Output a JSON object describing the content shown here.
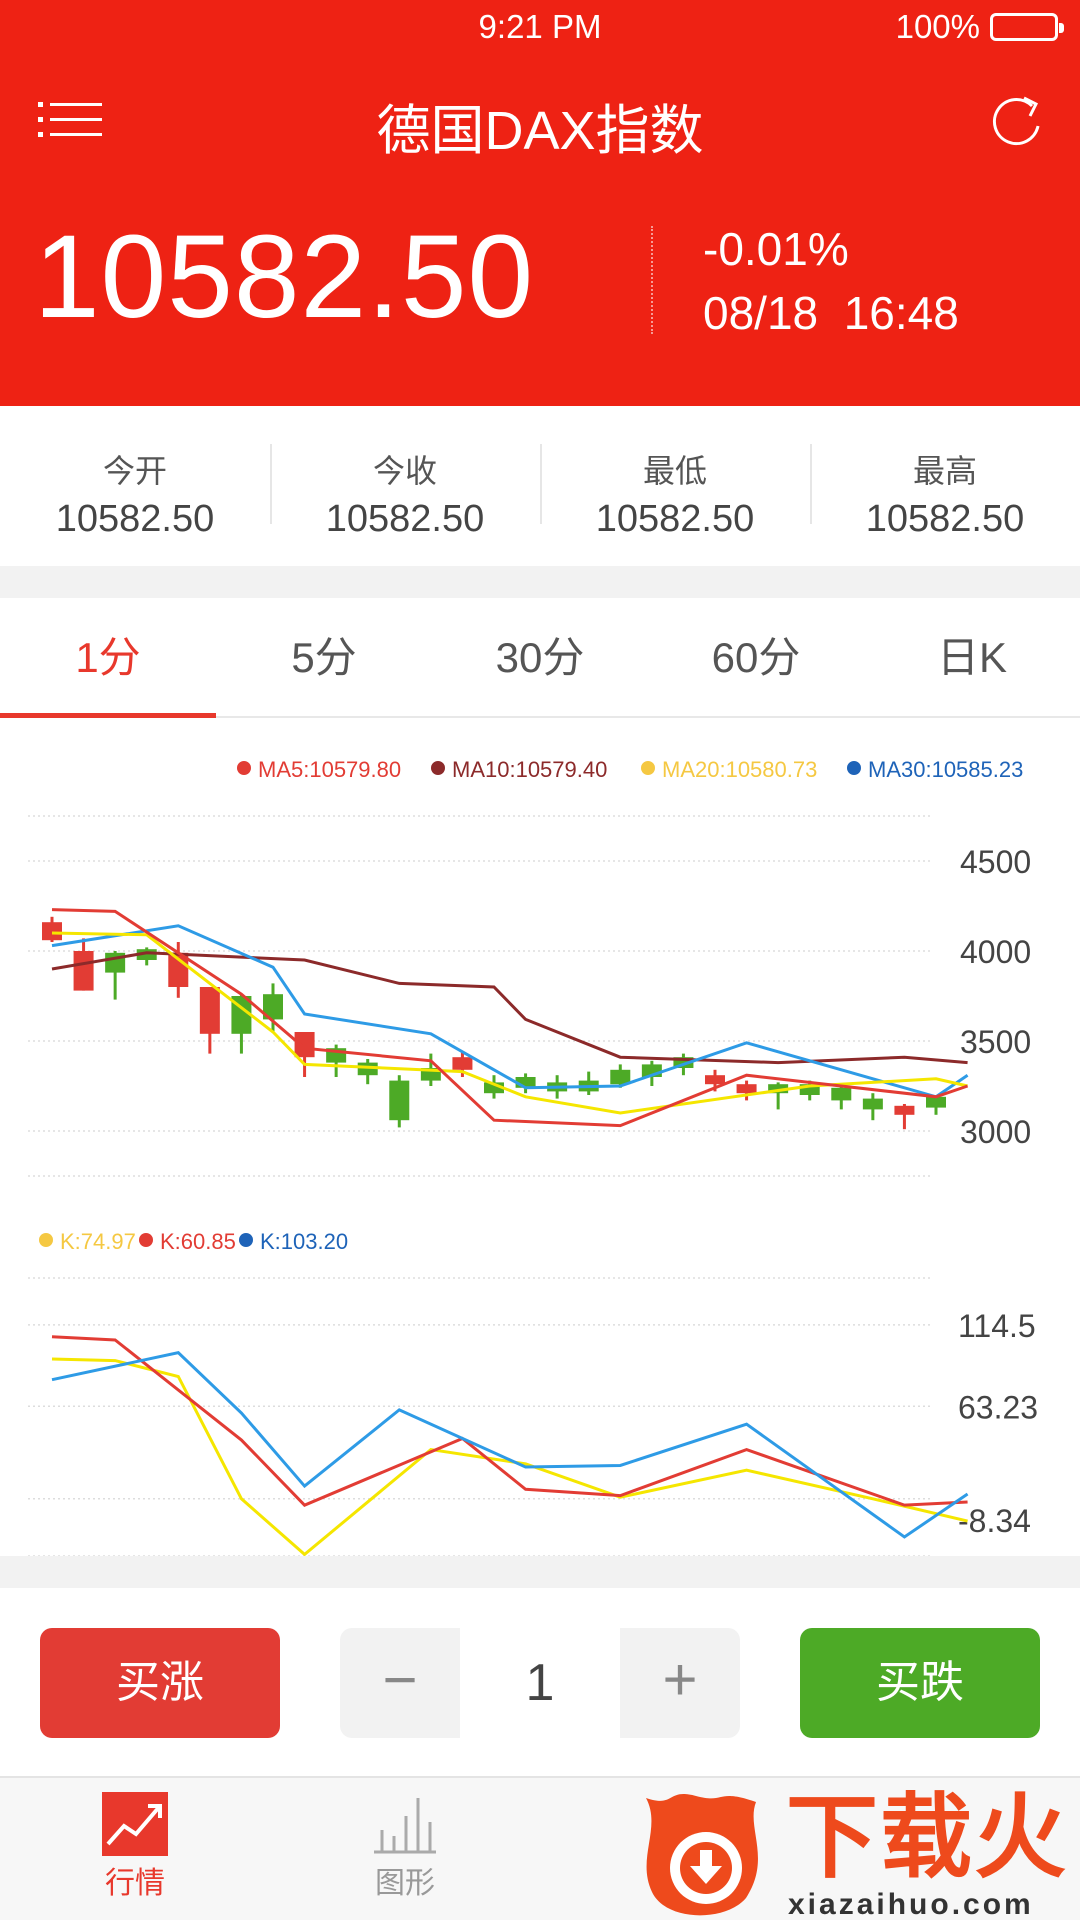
{
  "status_bar": {
    "time": "9:21 PM",
    "battery": "100%"
  },
  "header": {
    "title": "德国DAX指数",
    "price": "10582.50",
    "change": "-0.01%",
    "date": "08/18",
    "time": "16:48"
  },
  "stats": [
    {
      "label": "今开",
      "value": "10582.50"
    },
    {
      "label": "今收",
      "value": "10582.50"
    },
    {
      "label": "最低",
      "value": "10582.50"
    },
    {
      "label": "最高",
      "value": "10582.50"
    }
  ],
  "tabs": [
    "1分",
    "5分",
    "30分",
    "60分",
    "日K"
  ],
  "active_tab": 0,
  "colors": {
    "brand": "#ee2214",
    "up": "#e23c34",
    "down": "#4daa26",
    "ma5": "#e23c34",
    "ma10": "#8c2a2a",
    "ma20": "#f5e600",
    "ma30": "#2e9be6"
  },
  "chart_data": [
    {
      "type": "candlestick",
      "legend": [
        {
          "name": "MA5",
          "value": "10579.80",
          "color": "#e23c34"
        },
        {
          "name": "MA10",
          "value": "10579.40",
          "color": "#8c2a2a"
        },
        {
          "name": "MA20",
          "value": "10580.73",
          "color": "#f5c842"
        },
        {
          "name": "MA30",
          "value": "10585.23",
          "color": "#1e63b8"
        }
      ],
      "y_ticks": [
        "4500",
        "4000",
        "3500",
        "3000"
      ],
      "ylim": [
        2750,
        4750
      ],
      "candles": [
        {
          "o": 4160,
          "c": 4060,
          "h": 4190,
          "l": 4050
        },
        {
          "o": 4000,
          "c": 3780,
          "h": 4070,
          "l": 3780
        },
        {
          "o": 3880,
          "c": 3990,
          "h": 4000,
          "l": 3730
        },
        {
          "o": 3950,
          "c": 4010,
          "h": 4020,
          "l": 3920
        },
        {
          "o": 3990,
          "c": 3800,
          "h": 4050,
          "l": 3740
        },
        {
          "o": 3800,
          "c": 3540,
          "h": 3800,
          "l": 3430
        },
        {
          "o": 3540,
          "c": 3750,
          "h": 3760,
          "l": 3430
        },
        {
          "o": 3620,
          "c": 3760,
          "h": 3820,
          "l": 3550
        },
        {
          "o": 3550,
          "c": 3410,
          "h": 3550,
          "l": 3300
        },
        {
          "o": 3380,
          "c": 3460,
          "h": 3480,
          "l": 3300
        },
        {
          "o": 3310,
          "c": 3380,
          "h": 3400,
          "l": 3260
        },
        {
          "o": 3060,
          "c": 3280,
          "h": 3310,
          "l": 3020
        },
        {
          "o": 3280,
          "c": 3350,
          "h": 3430,
          "l": 3250
        },
        {
          "o": 3410,
          "c": 3340,
          "h": 3440,
          "l": 3300
        },
        {
          "o": 3210,
          "c": 3270,
          "h": 3310,
          "l": 3180
        },
        {
          "o": 3240,
          "c": 3300,
          "h": 3320,
          "l": 3210
        },
        {
          "o": 3220,
          "c": 3270,
          "h": 3310,
          "l": 3180
        },
        {
          "o": 3220,
          "c": 3280,
          "h": 3330,
          "l": 3200
        },
        {
          "o": 3260,
          "c": 3340,
          "h": 3370,
          "l": 3240
        },
        {
          "o": 3300,
          "c": 3370,
          "h": 3390,
          "l": 3250
        },
        {
          "o": 3350,
          "c": 3410,
          "h": 3430,
          "l": 3310
        },
        {
          "o": 3310,
          "c": 3260,
          "h": 3340,
          "l": 3220
        },
        {
          "o": 3260,
          "c": 3210,
          "h": 3280,
          "l": 3170
        },
        {
          "o": 3210,
          "c": 3260,
          "h": 3270,
          "l": 3120
        },
        {
          "o": 3200,
          "c": 3260,
          "h": 3280,
          "l": 3170
        },
        {
          "o": 3170,
          "c": 3240,
          "h": 3260,
          "l": 3120
        },
        {
          "o": 3120,
          "c": 3180,
          "h": 3210,
          "l": 3060
        },
        {
          "o": 3140,
          "c": 3090,
          "h": 3150,
          "l": 3010
        },
        {
          "o": 3130,
          "c": 3190,
          "h": 3200,
          "l": 3090
        }
      ],
      "ma_lines": {
        "MA5": [
          [
            0,
            4230
          ],
          [
            2,
            4220
          ],
          [
            6,
            3760
          ],
          [
            8,
            3460
          ],
          [
            12,
            3390
          ],
          [
            14,
            3060
          ],
          [
            18,
            3030
          ],
          [
            22,
            3310
          ],
          [
            28,
            3190
          ],
          [
            29,
            3250
          ]
        ],
        "MA10": [
          [
            0,
            3900
          ],
          [
            3,
            3990
          ],
          [
            8,
            3950
          ],
          [
            11,
            3820
          ],
          [
            14,
            3800
          ],
          [
            15,
            3620
          ],
          [
            18,
            3410
          ],
          [
            23,
            3380
          ],
          [
            27,
            3410
          ],
          [
            29,
            3380
          ]
        ],
        "MA20": [
          [
            0,
            4100
          ],
          [
            3,
            4090
          ],
          [
            5,
            3820
          ],
          [
            7,
            3550
          ],
          [
            8,
            3370
          ],
          [
            13,
            3330
          ],
          [
            15,
            3190
          ],
          [
            18,
            3100
          ],
          [
            24,
            3250
          ],
          [
            28,
            3290
          ],
          [
            29,
            3250
          ]
        ],
        "MA30": [
          [
            0,
            4030
          ],
          [
            4,
            4140
          ],
          [
            7,
            3910
          ],
          [
            8,
            3650
          ],
          [
            12,
            3540
          ],
          [
            15,
            3240
          ],
          [
            18,
            3250
          ],
          [
            22,
            3490
          ],
          [
            28,
            3190
          ],
          [
            29,
            3310
          ]
        ]
      }
    },
    {
      "type": "line",
      "legend": [
        {
          "name": "K",
          "value": "74.97",
          "color": "#f5c842"
        },
        {
          "name": "K",
          "value": "60.85",
          "color": "#e23c34"
        },
        {
          "name": "K",
          "value": "103.20",
          "color": "#1e63b8"
        }
      ],
      "y_ticks": [
        "114.5",
        "63.23",
        "-8.34"
      ],
      "ylim": [
        -31,
        144
      ],
      "series": [
        {
          "name": "K",
          "color": "#f5e600",
          "points": [
            [
              0,
              93
            ],
            [
              2,
              92
            ],
            [
              4,
              82
            ],
            [
              6,
              5
            ],
            [
              8,
              -30
            ],
            [
              12,
              36
            ],
            [
              15,
              27
            ],
            [
              18,
              6
            ],
            [
              22,
              23
            ],
            [
              26,
              5
            ],
            [
              29,
              -9
            ]
          ]
        },
        {
          "name": "K",
          "color": "#e23c34",
          "points": [
            [
              0,
              107
            ],
            [
              2,
              105
            ],
            [
              6,
              42
            ],
            [
              8,
              1
            ],
            [
              13,
              43
            ],
            [
              15,
              11
            ],
            [
              18,
              7
            ],
            [
              22,
              36
            ],
            [
              27,
              1
            ],
            [
              29,
              3
            ]
          ]
        },
        {
          "name": "K",
          "color": "#2e9be6",
          "points": [
            [
              0,
              80
            ],
            [
              4,
              97
            ],
            [
              6,
              59
            ],
            [
              8,
              13
            ],
            [
              11,
              61
            ],
            [
              15,
              25
            ],
            [
              18,
              26
            ],
            [
              22,
              52
            ],
            [
              27,
              -19
            ],
            [
              29,
              8
            ]
          ]
        }
      ]
    }
  ],
  "trade": {
    "buy_up": "买涨",
    "buy_down": "买跌",
    "minus": "−",
    "plus": "+",
    "quantity": "1"
  },
  "nav": {
    "home": "行情",
    "chart": "图形"
  },
  "promo": {
    "text": "下载火",
    "url": "xiazaihuo.com"
  }
}
